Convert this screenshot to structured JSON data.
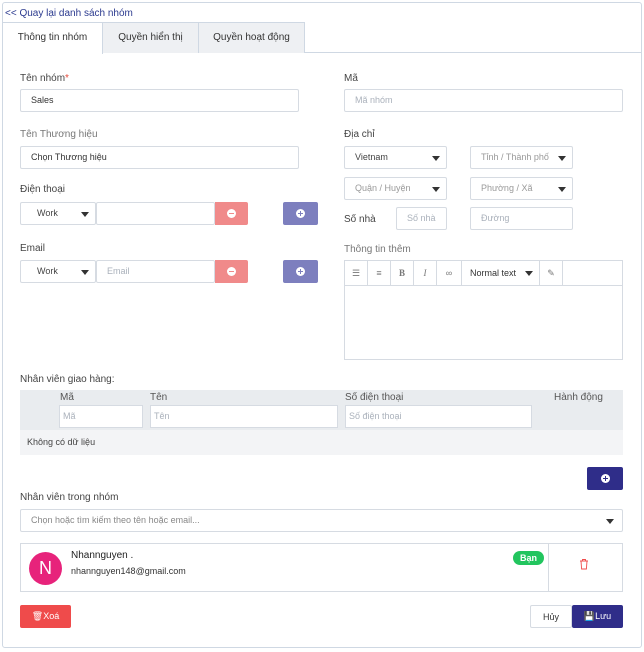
{
  "back_link": "<< Quay lại danh sách nhóm",
  "tabs": [
    {
      "label": "Thông tin nhóm",
      "active": true
    },
    {
      "label": "Quyền hiển thị",
      "active": false
    },
    {
      "label": "Quyền hoạt động",
      "active": false
    }
  ],
  "form": {
    "group_name": {
      "label": "Tên nhóm",
      "required_mark": "*",
      "value": "Sales"
    },
    "code": {
      "label": "Mã",
      "placeholder": "Mã nhóm"
    },
    "brand": {
      "label": "Tên Thương hiệu",
      "value": "Chọn Thương hiệu"
    },
    "address": {
      "label": "Địa chỉ",
      "country": "Vietnam",
      "province": "Tỉnh / Thành phố",
      "district": "Quận / Huyện",
      "ward": "Phường / Xã",
      "house_label": "Số nhà",
      "house_placeholder": "Số nhà",
      "street_placeholder": "Đường"
    },
    "phone": {
      "label": "Điện thoại",
      "type": "Work",
      "value": ""
    },
    "email": {
      "label": "Email",
      "type": "Work",
      "placeholder": "Email"
    },
    "extra_info": {
      "label": "Thông tin thêm",
      "format_select": "Normal text"
    }
  },
  "delivery": {
    "label": "Nhân viên giao hàng:",
    "columns": [
      "Mã",
      "Tên",
      "Số điện thoại",
      "Hành động"
    ],
    "placeholders": [
      "Mã",
      "Tên",
      "Số điện thoại"
    ],
    "empty_text": "Không có dữ liệu"
  },
  "members": {
    "label": "Nhân viên trong nhóm",
    "search_placeholder": "Chọn hoặc tìm kiếm theo tên hoặc email...",
    "list": [
      {
        "avatar": "N",
        "name": "Nhannguyen .",
        "email": "nhannguyen148@gmail.com",
        "badge": "Bạn"
      }
    ]
  },
  "actions": {
    "delete": "Xoá",
    "cancel": "Hủy",
    "save": "Lưu"
  },
  "colors": {
    "primary": "#2f2d89",
    "danger": "#ef4b4b",
    "badge": "#22c55e",
    "avatar": "#e7237b"
  }
}
